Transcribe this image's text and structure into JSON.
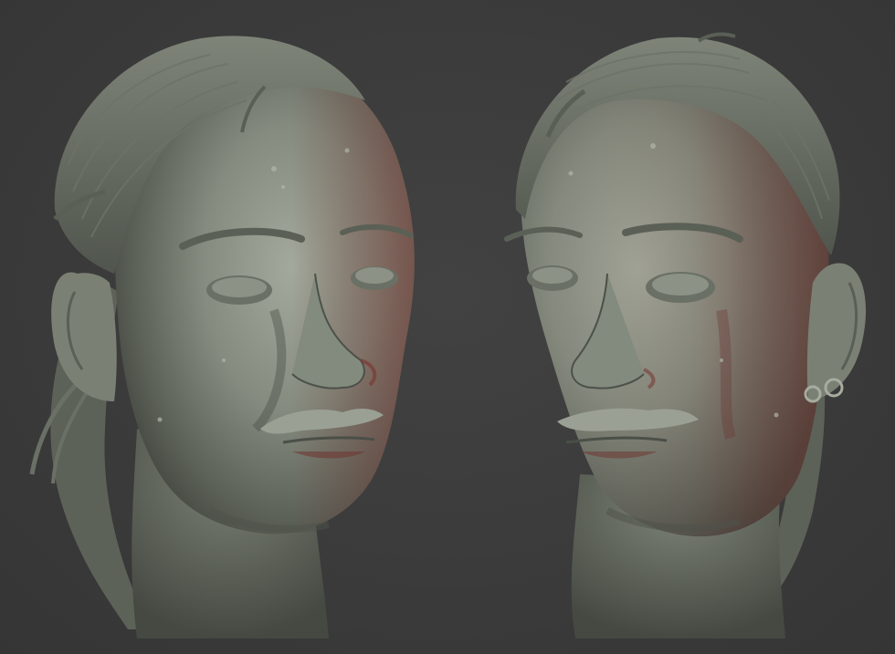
{
  "scene": {
    "background_color": "#3a3a3a",
    "clay_color": "#8a9085",
    "clay_shadow_color": "#4a4f48",
    "rim_light_color": "#7a3a34",
    "views": [
      {
        "id": "three-quarter-left",
        "label": ""
      },
      {
        "id": "three-quarter-right",
        "label": ""
      }
    ]
  }
}
